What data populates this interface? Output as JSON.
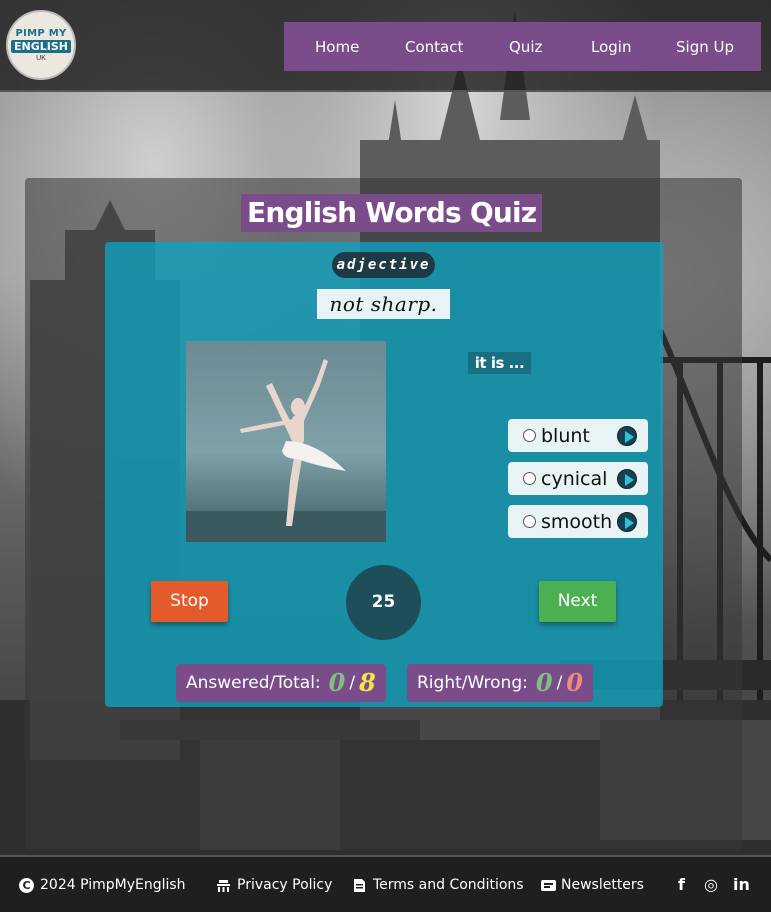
{
  "header": {
    "logo": {
      "line1": "PIMP MY",
      "line2": "ENGLISH",
      "line3": "UK"
    },
    "nav": [
      {
        "label": "Home"
      },
      {
        "label": "Contact"
      },
      {
        "label": "Quiz"
      },
      {
        "label": "Login"
      },
      {
        "label": "Sign Up"
      }
    ]
  },
  "quiz": {
    "title": "English Words Quiz",
    "part_of_speech": "adjective",
    "definition": "not sharp.",
    "prompt": "it is ...",
    "options": [
      {
        "word": "blunt"
      },
      {
        "word": "cynical"
      },
      {
        "word": "smooth"
      }
    ],
    "stop_label": "Stop",
    "next_label": "Next",
    "timer": "25",
    "answered_label": "Answered/Total:",
    "answered": "0",
    "total": "8",
    "rightwrong_label": "Right/Wrong:",
    "right": "0",
    "wrong": "0",
    "colors": {
      "answered": "#7ec27e",
      "total": "#f2e64a",
      "right": "#7ec27e",
      "wrong": "#f08a7a"
    }
  },
  "footer": {
    "copyright": "2024 PimpMyEnglish",
    "links": [
      {
        "label": "Privacy Policy",
        "icon": "privacy-icon"
      },
      {
        "label": "Terms and Conditions",
        "icon": "document-icon"
      },
      {
        "label": "Newsletters",
        "icon": "newsletter-icon"
      }
    ],
    "social": [
      {
        "label": "f",
        "icon": "facebook-icon"
      },
      {
        "label": "◎",
        "icon": "instagram-icon"
      },
      {
        "label": "in",
        "icon": "linkedin-icon"
      }
    ]
  }
}
